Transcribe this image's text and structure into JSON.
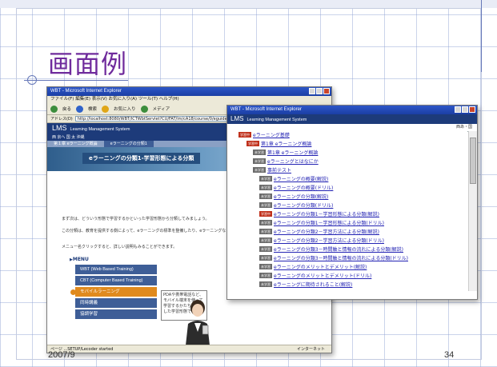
{
  "slide": {
    "title": "画面例",
    "date": "2007/9",
    "page": "34"
  },
  "window1": {
    "titlebar": "WBT - Microsoft Internet Explorer",
    "menubar": "ファイル(F)  編集(E)  表示(V)  お気に入り(A)  ツール(T)  ヘルプ(H)",
    "toolbar": [
      "戻る",
      "検索",
      "お気に入り",
      "メディア"
    ],
    "address_label": "アドレス(D)",
    "address": "http://localhost:8080/WBT/ICTWbtServlet?CU/FAT/lm/cA18/course/0/eguide...",
    "lms_title": "LMS",
    "lms_subtitle": "Learning Management System",
    "user": "西 京へ 国 太 沖縄",
    "nav": [
      "第１章 eラーニング概論",
      "eラーニングの分類1"
    ],
    "banner": "eラーニングの分類1-学習形態による分類",
    "para1": [
      "まず次は、どういう形態で学習するかといった学習形態から分類してみましょう。",
      "この分類は、教育を提供する側によって、eラーニングの標準を整備したり、eラーニングなどがあります。"
    ],
    "para2": "メニュー名クリックすると、詳しい説明もみることができます。",
    "menu_heading": "MENU",
    "menu": [
      "WBT (Web Based Training)",
      "CBT (Computer Based Training)",
      "モバイルラーニング",
      "同時講義",
      "協調学習"
    ],
    "infobox": "PDAや携帯電話など、モバイル端末を使って学習するかたちを利用した学習形態です。",
    "status_left": "ページ ...SETUP/Lecoder started",
    "status_right": "インターネット"
  },
  "window2": {
    "titlebar": "WBT - Microsoft Internet Explorer",
    "lms_title": "LMS",
    "lms_subtitle": "Learning Management System",
    "sub_right": "西あ・国",
    "items": [
      {
        "tag": "学習中",
        "tagcolor": "red",
        "label": "eラーニング基礎"
      },
      {
        "tag": "学習中",
        "tagcolor": "red",
        "label": "第1章 eラーニング概論"
      },
      {
        "tag": "未学習",
        "tagcolor": "grey",
        "label": "第1章 eラーニング概論"
      },
      {
        "tag": "未学習",
        "tagcolor": "grey",
        "label": "eラーニングとはなにか"
      },
      {
        "tag": "未学習",
        "tagcolor": "grey",
        "label": "事前テスト"
      },
      {
        "tag": "未学習",
        "tagcolor": "grey",
        "label": "eラーニングの概要(解説)"
      },
      {
        "tag": "未学習",
        "tagcolor": "grey",
        "label": "eラーニングの概要(ドリル)"
      },
      {
        "tag": "未学習",
        "tagcolor": "grey",
        "label": "eラーニングの分類(解説)"
      },
      {
        "tag": "未学習",
        "tagcolor": "grey",
        "label": "eラーニングの分類(ドリル)"
      },
      {
        "tag": "学習中",
        "tagcolor": "red",
        "label": "eラーニングの分類1－学習形態による分類(解説)"
      },
      {
        "tag": "未学習",
        "tagcolor": "grey",
        "label": "eラーニングの分類1－学習形態による分類(ドリル)"
      },
      {
        "tag": "未学習",
        "tagcolor": "grey",
        "label": "eラーニングの分類2－学習方法による分類(解説)"
      },
      {
        "tag": "未学習",
        "tagcolor": "grey",
        "label": "eラーニングの分類2－学習方法による分類(ドリル)"
      },
      {
        "tag": "未学習",
        "tagcolor": "grey",
        "label": "eラーニングの分類3－時間軸と情報の流れによる分類(解説)"
      },
      {
        "tag": "未学習",
        "tagcolor": "grey",
        "label": "eラーニングの分類3－時間軸と情報の流れによる分類(ドリル)"
      },
      {
        "tag": "未学習",
        "tagcolor": "grey",
        "label": "eラーニングのメリットとデメリット(解説)"
      },
      {
        "tag": "未学習",
        "tagcolor": "grey",
        "label": "eラーニングのメリットとデメリット(ドリル)"
      },
      {
        "tag": "未学習",
        "tagcolor": "grey",
        "label": "eラーニングに期待されること(解説)"
      }
    ]
  }
}
